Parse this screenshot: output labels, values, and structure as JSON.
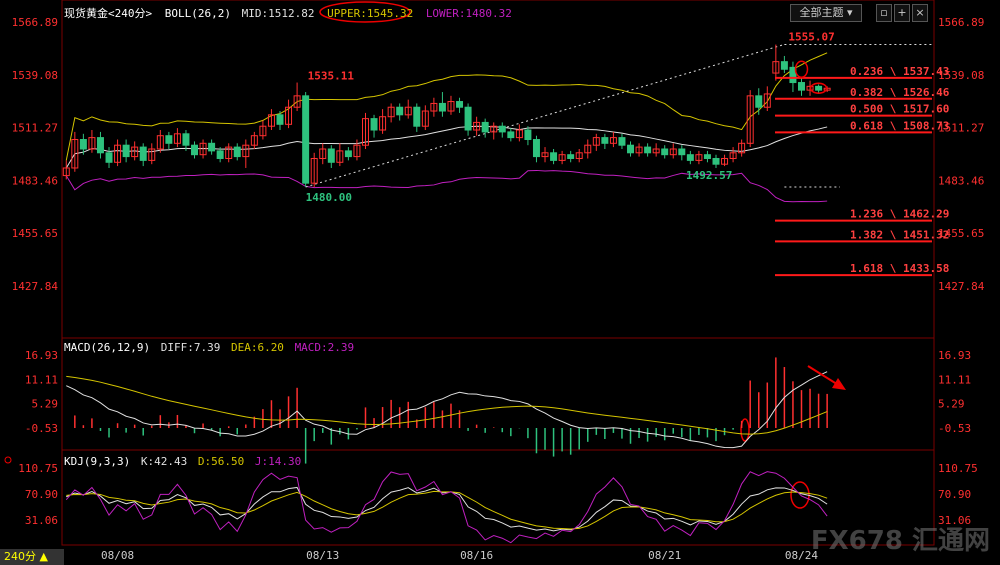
{
  "header": {
    "symbol": "现货黄金<240分>",
    "boll_label": "BOLL(26,2)",
    "mid": "MID:1512.82",
    "upper": "UPPER:1545.32",
    "lower": "LOWER:1480.32",
    "theme_button": "全部主题"
  },
  "macd_header": {
    "label": "MACD(26,12,9)",
    "diff": "DIFF:7.39",
    "dea": "DEA:6.20",
    "macd": "MACD:2.39"
  },
  "kdj_header": {
    "label": "KDJ(9,3,3)",
    "k": "K:42.43",
    "d": "D:56.50",
    "j": "J:14.30"
  },
  "timeframe": "240分",
  "watermark": {
    "brand": "FX678",
    "cn": "汇通网"
  },
  "colors": {
    "up": "#ff3030",
    "down": "#2ec27e",
    "upper": "#d4c400",
    "mid": "#e0e0e0",
    "lower": "#c020c0",
    "fib": "#ff1a1a"
  },
  "chart_data": {
    "type": "candlestick",
    "price_axis_ticks": [
      "1566.89",
      "1539.08",
      "1511.27",
      "1483.46",
      "1455.65",
      "1427.84"
    ],
    "macd_axis_ticks": [
      "16.93",
      "11.11",
      "5.29",
      "-0.53"
    ],
    "kdj_axis_ticks": [
      "110.75",
      "70.90",
      "31.06"
    ],
    "date_labels": [
      "08/08",
      "08/13",
      "08/16",
      "08/21",
      "08/24"
    ],
    "price_annotations": [
      "1535.11",
      "1480.00",
      "1492.57",
      "1555.07"
    ],
    "fib_levels": [
      {
        "label": "0.236 \\ 1537.43",
        "value": 1537.43
      },
      {
        "label": "0.382 \\ 1526.46",
        "value": 1526.46
      },
      {
        "label": "0.500 \\ 1517.60",
        "value": 1517.6
      },
      {
        "label": "0.618 \\ 1508.73",
        "value": 1508.73
      },
      {
        "label": "1.236 \\ 1462.29",
        "value": 1462.29
      },
      {
        "label": "1.382 \\ 1451.32",
        "value": 1451.32
      },
      {
        "label": "1.618 \\ 1433.58",
        "value": 1433.58
      }
    ],
    "candles": [
      {
        "o": 1486,
        "c": 1490,
        "h": 1494,
        "l": 1484
      },
      {
        "o": 1490,
        "c": 1505,
        "h": 1509,
        "l": 1488
      },
      {
        "o": 1505,
        "c": 1500,
        "h": 1508,
        "l": 1497
      },
      {
        "o": 1500,
        "c": 1506,
        "h": 1510,
        "l": 1498
      },
      {
        "o": 1506,
        "c": 1498,
        "h": 1509,
        "l": 1495
      },
      {
        "o": 1498,
        "c": 1493,
        "h": 1501,
        "l": 1490
      },
      {
        "o": 1493,
        "c": 1502,
        "h": 1505,
        "l": 1491
      },
      {
        "o": 1502,
        "c": 1496,
        "h": 1505,
        "l": 1493
      },
      {
        "o": 1496,
        "c": 1501,
        "h": 1504,
        "l": 1494
      },
      {
        "o": 1501,
        "c": 1494,
        "h": 1503,
        "l": 1491
      },
      {
        "o": 1494,
        "c": 1500,
        "h": 1503,
        "l": 1492
      },
      {
        "o": 1500,
        "c": 1507,
        "h": 1510,
        "l": 1498
      },
      {
        "o": 1507,
        "c": 1503,
        "h": 1509,
        "l": 1500
      },
      {
        "o": 1503,
        "c": 1508,
        "h": 1511,
        "l": 1501
      },
      {
        "o": 1508,
        "c": 1502,
        "h": 1510,
        "l": 1499
      },
      {
        "o": 1502,
        "c": 1497,
        "h": 1504,
        "l": 1495
      },
      {
        "o": 1497,
        "c": 1503,
        "h": 1505,
        "l": 1495
      },
      {
        "o": 1503,
        "c": 1499,
        "h": 1505,
        "l": 1497
      },
      {
        "o": 1499,
        "c": 1495,
        "h": 1501,
        "l": 1493
      },
      {
        "o": 1495,
        "c": 1501,
        "h": 1503,
        "l": 1493
      },
      {
        "o": 1501,
        "c": 1496,
        "h": 1503,
        "l": 1494
      },
      {
        "o": 1496,
        "c": 1502,
        "h": 1505,
        "l": 1490
      },
      {
        "o": 1502,
        "c": 1507,
        "h": 1509,
        "l": 1500
      },
      {
        "o": 1507,
        "c": 1512,
        "h": 1515,
        "l": 1505
      },
      {
        "o": 1512,
        "c": 1518,
        "h": 1521,
        "l": 1510
      },
      {
        "o": 1518,
        "c": 1513,
        "h": 1520,
        "l": 1510
      },
      {
        "o": 1513,
        "c": 1522,
        "h": 1526,
        "l": 1511
      },
      {
        "o": 1522,
        "c": 1528,
        "h": 1535,
        "l": 1520
      },
      {
        "o": 1528,
        "c": 1482,
        "h": 1530,
        "l": 1480
      },
      {
        "o": 1482,
        "c": 1495,
        "h": 1498,
        "l": 1480
      },
      {
        "o": 1495,
        "c": 1500,
        "h": 1503,
        "l": 1492
      },
      {
        "o": 1500,
        "c": 1493,
        "h": 1502,
        "l": 1490
      },
      {
        "o": 1493,
        "c": 1499,
        "h": 1503,
        "l": 1491
      },
      {
        "o": 1499,
        "c": 1496,
        "h": 1501,
        "l": 1494
      },
      {
        "o": 1496,
        "c": 1502,
        "h": 1505,
        "l": 1494
      },
      {
        "o": 1502,
        "c": 1516,
        "h": 1519,
        "l": 1500
      },
      {
        "o": 1516,
        "c": 1510,
        "h": 1518,
        "l": 1506
      },
      {
        "o": 1510,
        "c": 1517,
        "h": 1521,
        "l": 1508
      },
      {
        "o": 1517,
        "c": 1522,
        "h": 1524,
        "l": 1514
      },
      {
        "o": 1522,
        "c": 1518,
        "h": 1524,
        "l": 1515
      },
      {
        "o": 1518,
        "c": 1522,
        "h": 1526,
        "l": 1516
      },
      {
        "o": 1522,
        "c": 1512,
        "h": 1524,
        "l": 1509
      },
      {
        "o": 1512,
        "c": 1520,
        "h": 1523,
        "l": 1510
      },
      {
        "o": 1520,
        "c": 1524,
        "h": 1527,
        "l": 1517
      },
      {
        "o": 1524,
        "c": 1520,
        "h": 1530,
        "l": 1517
      },
      {
        "o": 1520,
        "c": 1525,
        "h": 1528,
        "l": 1518
      },
      {
        "o": 1525,
        "c": 1522,
        "h": 1527,
        "l": 1519
      },
      {
        "o": 1522,
        "c": 1510,
        "h": 1524,
        "l": 1507
      },
      {
        "o": 1510,
        "c": 1514,
        "h": 1517,
        "l": 1507
      },
      {
        "o": 1514,
        "c": 1509,
        "h": 1516,
        "l": 1506
      },
      {
        "o": 1509,
        "c": 1512,
        "h": 1514,
        "l": 1505
      },
      {
        "o": 1512,
        "c": 1509,
        "h": 1514,
        "l": 1506
      },
      {
        "o": 1509,
        "c": 1506,
        "h": 1511,
        "l": 1504
      },
      {
        "o": 1506,
        "c": 1510,
        "h": 1513,
        "l": 1504
      },
      {
        "o": 1510,
        "c": 1505,
        "h": 1512,
        "l": 1502
      },
      {
        "o": 1505,
        "c": 1496,
        "h": 1507,
        "l": 1493
      },
      {
        "o": 1496,
        "c": 1498,
        "h": 1501,
        "l": 1493
      },
      {
        "o": 1498,
        "c": 1494,
        "h": 1500,
        "l": 1492
      },
      {
        "o": 1494,
        "c": 1497,
        "h": 1499,
        "l": 1492
      },
      {
        "o": 1497,
        "c": 1495,
        "h": 1499,
        "l": 1493
      },
      {
        "o": 1495,
        "c": 1498,
        "h": 1500,
        "l": 1493
      },
      {
        "o": 1498,
        "c": 1502,
        "h": 1505,
        "l": 1495
      },
      {
        "o": 1502,
        "c": 1506,
        "h": 1508,
        "l": 1499
      },
      {
        "o": 1506,
        "c": 1503,
        "h": 1508,
        "l": 1500
      },
      {
        "o": 1503,
        "c": 1506,
        "h": 1509,
        "l": 1501
      },
      {
        "o": 1506,
        "c": 1502,
        "h": 1508,
        "l": 1500
      },
      {
        "o": 1502,
        "c": 1498,
        "h": 1504,
        "l": 1496
      },
      {
        "o": 1498,
        "c": 1501,
        "h": 1503,
        "l": 1496
      },
      {
        "o": 1501,
        "c": 1498,
        "h": 1503,
        "l": 1496
      },
      {
        "o": 1498,
        "c": 1500,
        "h": 1503,
        "l": 1496
      },
      {
        "o": 1500,
        "c": 1497,
        "h": 1502,
        "l": 1495
      },
      {
        "o": 1497,
        "c": 1500,
        "h": 1503,
        "l": 1495
      },
      {
        "o": 1500,
        "c": 1497,
        "h": 1502,
        "l": 1494
      },
      {
        "o": 1497,
        "c": 1494,
        "h": 1499,
        "l": 1492
      },
      {
        "o": 1494,
        "c": 1497,
        "h": 1499,
        "l": 1492
      },
      {
        "o": 1497,
        "c": 1495,
        "h": 1499,
        "l": 1493
      },
      {
        "o": 1495,
        "c": 1492,
        "h": 1497,
        "l": 1490
      },
      {
        "o": 1492,
        "c": 1495,
        "h": 1497,
        "l": 1491
      },
      {
        "o": 1495,
        "c": 1498,
        "h": 1501,
        "l": 1493
      },
      {
        "o": 1498,
        "c": 1503,
        "h": 1505,
        "l": 1496
      },
      {
        "o": 1503,
        "c": 1528,
        "h": 1531,
        "l": 1501
      },
      {
        "o": 1528,
        "c": 1522,
        "h": 1532,
        "l": 1518
      },
      {
        "o": 1522,
        "c": 1529,
        "h": 1533,
        "l": 1520
      },
      {
        "o": 1540,
        "c": 1546,
        "h": 1555,
        "l": 1536
      },
      {
        "o": 1546,
        "c": 1542,
        "h": 1549,
        "l": 1540
      },
      {
        "o": 1543,
        "c": 1535,
        "h": 1546,
        "l": 1530
      },
      {
        "o": 1535,
        "c": 1531,
        "h": 1538,
        "l": 1528
      },
      {
        "o": 1531,
        "c": 1533,
        "h": 1536,
        "l": 1528
      },
      {
        "o": 1533,
        "c": 1531,
        "h": 1534,
        "l": 1529
      },
      {
        "o": 1531,
        "c": 1532,
        "h": 1533,
        "l": 1530
      }
    ]
  }
}
